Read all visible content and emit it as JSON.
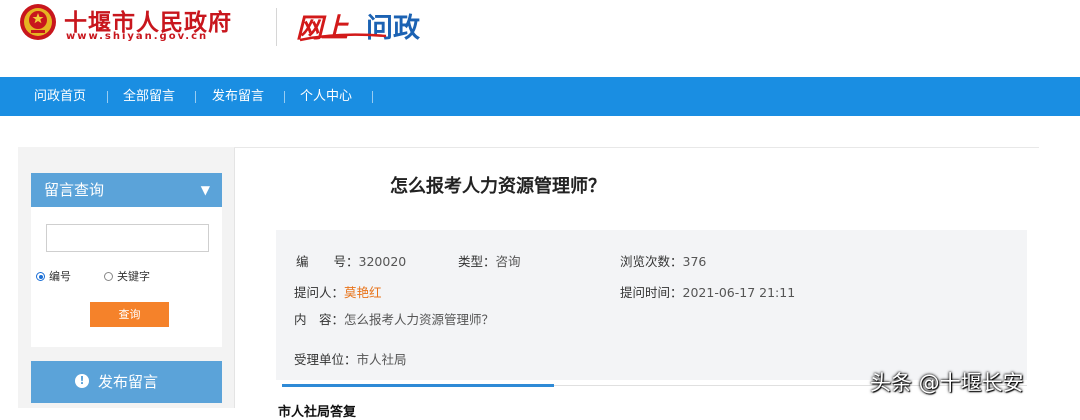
{
  "header": {
    "site_name": "十堰市人民政府",
    "site_url": "www.shiyan.gov.cn",
    "brand_part1": "网上",
    "brand_part2": "问政"
  },
  "nav": {
    "items": [
      {
        "label": "问政首页"
      },
      {
        "label": "全部留言"
      },
      {
        "label": "发布留言"
      },
      {
        "label": "个人中心"
      }
    ]
  },
  "sidebar": {
    "query_title": "留言查询",
    "search_value": "",
    "radio_number": "编号",
    "radio_keyword": "关键字",
    "query_button": "查询",
    "publish_button": "发布留言"
  },
  "question": {
    "title": "怎么报考人力资源管理师？",
    "number_label": "编　　号：",
    "number_value": "320020",
    "type_label": "类型：",
    "type_value": "咨询",
    "views_label": "浏览次数：",
    "views_value": "376",
    "asker_label": "提问人：",
    "asker_value": "莫艳红",
    "time_label": "提问时间：",
    "time_value": "2021-06-17 21:11",
    "content_label": "内　容：",
    "content_value": "怎么报考人力资源管理师？",
    "dept_label": "受理单位：",
    "dept_value": "市人社局"
  },
  "cut_heading": "市人社局答复",
  "watermark": "头条 @十堰长安",
  "colors": {
    "nav_bg": "#1a8ee2",
    "sidebar_header": "#5ba3d9",
    "query_button": "#f5822a",
    "site_red": "#c8161d",
    "asker_orange": "#e8741b"
  }
}
